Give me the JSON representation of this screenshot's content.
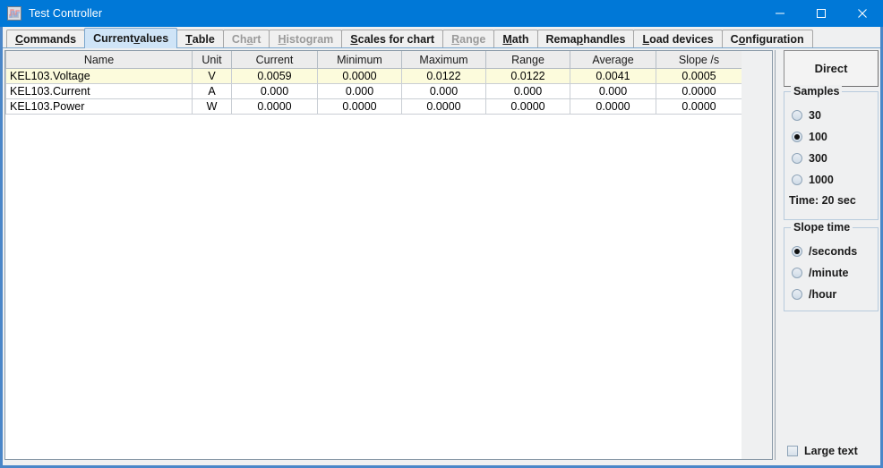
{
  "window": {
    "title": "Test Controller",
    "icon": "chart-waveform-icon",
    "minimize_label": "–",
    "maximize_label": "□",
    "close_label": "✕",
    "accent_color": "#0078d7",
    "border_color": "#4a86c8"
  },
  "tabs": [
    {
      "label": "Commands",
      "mnemonic": "C",
      "selected": false,
      "disabled": false
    },
    {
      "label": "Current values",
      "mnemonic": "v",
      "selected": true,
      "disabled": false
    },
    {
      "label": "Table",
      "mnemonic": "T",
      "selected": false,
      "disabled": false
    },
    {
      "label": "Chart",
      "mnemonic": "a",
      "selected": false,
      "disabled": true
    },
    {
      "label": "Histogram",
      "mnemonic": "H",
      "selected": false,
      "disabled": true
    },
    {
      "label": "Scales for chart",
      "mnemonic": "S",
      "selected": false,
      "disabled": false
    },
    {
      "label": "Range",
      "mnemonic": "R",
      "selected": false,
      "disabled": true
    },
    {
      "label": "Math",
      "mnemonic": "M",
      "selected": false,
      "disabled": false
    },
    {
      "label": "Remap handles",
      "mnemonic": "p",
      "selected": false,
      "disabled": false
    },
    {
      "label": "Load devices",
      "mnemonic": "L",
      "selected": false,
      "disabled": false
    },
    {
      "label": "Configuration",
      "mnemonic": "o",
      "selected": false,
      "disabled": false
    }
  ],
  "table": {
    "columns": [
      "Name",
      "Unit",
      "Current",
      "Minimum",
      "Maximum",
      "Range",
      "Average",
      "Slope /s"
    ],
    "highlight_color": "#fcfbdc",
    "rows": [
      {
        "highlighted": true,
        "cells": [
          "KEL103.Voltage",
          "V",
          "0.0059",
          "0.0000",
          "0.0122",
          "0.0122",
          "0.0041",
          "0.0005"
        ]
      },
      {
        "highlighted": false,
        "cells": [
          "KEL103.Current",
          "A",
          "0.000",
          "0.000",
          "0.000",
          "0.000",
          "0.000",
          "0.0000"
        ]
      },
      {
        "highlighted": false,
        "cells": [
          "KEL103.Power",
          "W",
          "0.0000",
          "0.0000",
          "0.0000",
          "0.0000",
          "0.0000",
          "0.0000"
        ]
      }
    ]
  },
  "panel": {
    "direct_label": "Direct",
    "samples": {
      "title": "Samples",
      "options": [
        {
          "label": "30",
          "selected": false
        },
        {
          "label": "100",
          "selected": true
        },
        {
          "label": "300",
          "selected": false
        },
        {
          "label": "1000",
          "selected": false
        }
      ],
      "time_note": "Time: 20 sec"
    },
    "slope_time": {
      "title": "Slope time",
      "options": [
        {
          "label": "/seconds",
          "selected": true
        },
        {
          "label": "/minute",
          "selected": false
        },
        {
          "label": "/hour",
          "selected": false
        }
      ]
    },
    "large_text": {
      "label": "Large text",
      "checked": false
    }
  }
}
